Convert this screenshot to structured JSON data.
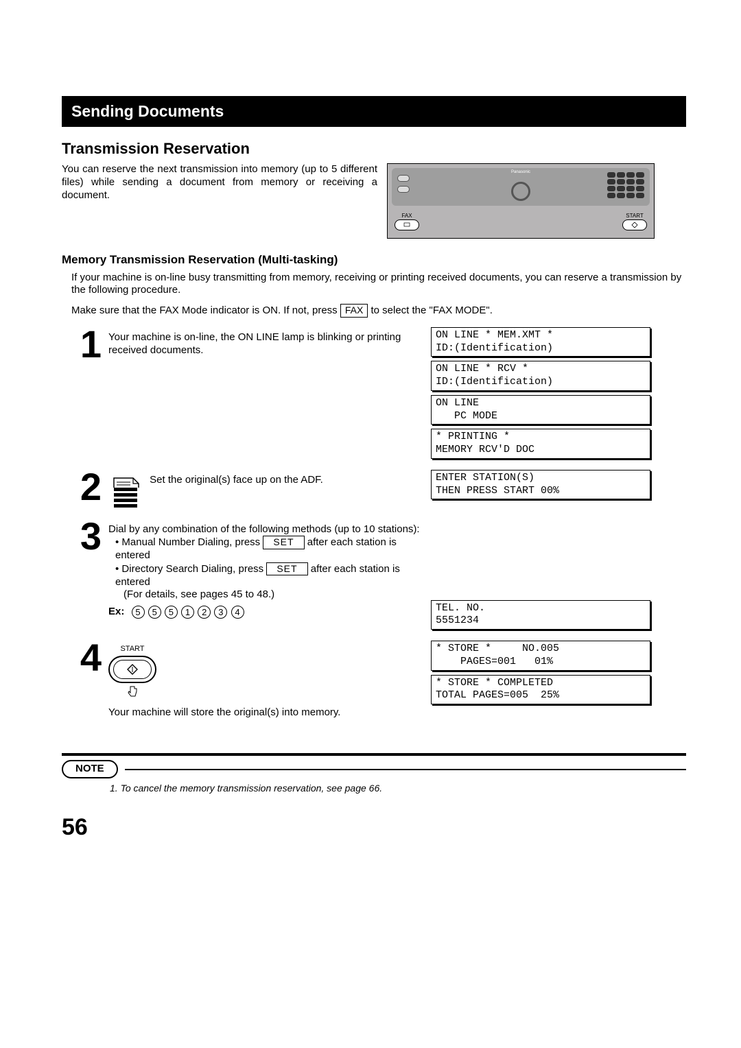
{
  "section_title": "Sending Documents",
  "h2": "Transmission Reservation",
  "intro": "You can reserve the next transmission into memory (up to 5 different files) while sending a document from memory or receiving a document.",
  "panel": {
    "brand": "Panasonic",
    "fax_label": "FAX",
    "start_label": "START"
  },
  "h3": "Memory Transmission Reservation (Multi-tasking)",
  "para1": "If your machine is on-line busy transmitting from memory, receiving or printing received documents, you can reserve a transmission by the following procedure.",
  "fax_line_pre": "Make sure that the FAX Mode indicator is ON.  If not, press ",
  "fax_key": "FAX",
  "fax_line_post": " to select the \"FAX MODE\".",
  "steps": {
    "s1": {
      "num": "1",
      "text": "Your machine is on-line, the ON LINE lamp is blinking or printing received documents.",
      "lcds": [
        "ON LINE * MEM.XMT *\nID:(Identification)",
        "ON LINE * RCV *\nID:(Identification)",
        "ON LINE\n   PC MODE",
        "* PRINTING *\nMEMORY RCV'D DOC"
      ]
    },
    "s2": {
      "num": "2",
      "text": " Set the original(s) face up on the ADF.",
      "lcd": "ENTER STATION(S)\nTHEN PRESS START 00%"
    },
    "s3": {
      "num": "3",
      "text_a": "Dial by any combination of the following methods (up to 10 stations):",
      "bullet1_pre": "Manual Number Dialing, press ",
      "bullet1_post": " after each station is entered",
      "bullet2_pre": "Directory Search Dialing, press ",
      "bullet2_post": " after each station is entered",
      "detail": "(For details, see pages 45 to 48.)",
      "set_label": "SET",
      "ex_label": "Ex:",
      "digits": [
        "5",
        "5",
        "5",
        "1",
        "2",
        "3",
        "4"
      ],
      "lcd": "TEL. NO.\n5551234"
    },
    "s4": {
      "num": "4",
      "start_label": "START",
      "after": "Your machine will store the original(s) into memory.",
      "lcds": [
        "* STORE *     NO.005\n    PAGES=001   01%",
        "* STORE * COMPLETED\nTOTAL PAGES=005  25%"
      ]
    }
  },
  "note_badge": "NOTE",
  "note_text": "1. To cancel the memory transmission reservation, see page 66.",
  "page_number": "56"
}
